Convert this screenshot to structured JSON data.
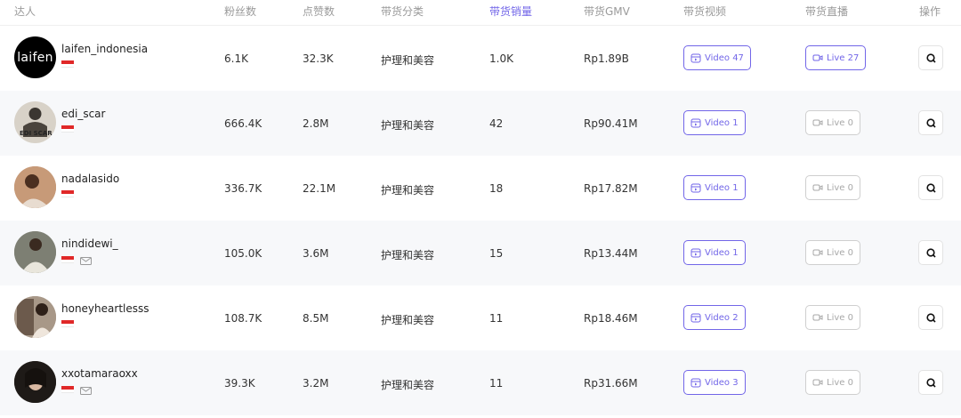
{
  "columns": {
    "creator": "达人",
    "followers": "粉丝数",
    "likes": "点赞数",
    "category": "带货分类",
    "sales": "带货销量",
    "gmv": "带货GMV",
    "videos": "带货视频",
    "lives": "带货直播",
    "actions": "操作"
  },
  "accent_color": "#7266e8",
  "rows": [
    {
      "name": "laifen_indonesia",
      "avatar_text": "laifen",
      "followers": "6.1K",
      "likes": "32.3K",
      "category": "护理和美容",
      "sales": "1.0K",
      "gmv": "Rp1.89B",
      "video": "Video 47",
      "live": "Live 27"
    },
    {
      "name": "edi_scar",
      "avatar_text": "EDI SCAR",
      "followers": "666.4K",
      "likes": "2.8M",
      "category": "护理和美容",
      "sales": "42",
      "gmv": "Rp90.41M",
      "video": "Video 1",
      "live": "Live 0"
    },
    {
      "name": "nadalasido",
      "followers": "336.7K",
      "likes": "22.1M",
      "category": "护理和美容",
      "sales": "18",
      "gmv": "Rp17.82M",
      "video": "Video 1",
      "live": "Live 0"
    },
    {
      "name": "nindidewi_",
      "followers": "105.0K",
      "likes": "3.6M",
      "category": "护理和美容",
      "sales": "15",
      "gmv": "Rp13.44M",
      "video": "Video 1",
      "live": "Live 0"
    },
    {
      "name": "honeyheartlesss",
      "followers": "108.7K",
      "likes": "8.5M",
      "category": "护理和美容",
      "sales": "11",
      "gmv": "Rp18.46M",
      "video": "Video 2",
      "live": "Live 0"
    },
    {
      "name": "xxotamaraoxx",
      "followers": "39.3K",
      "likes": "3.2M",
      "category": "护理和美容",
      "sales": "11",
      "gmv": "Rp31.66M",
      "video": "Video 3",
      "live": "Live 0"
    }
  ]
}
